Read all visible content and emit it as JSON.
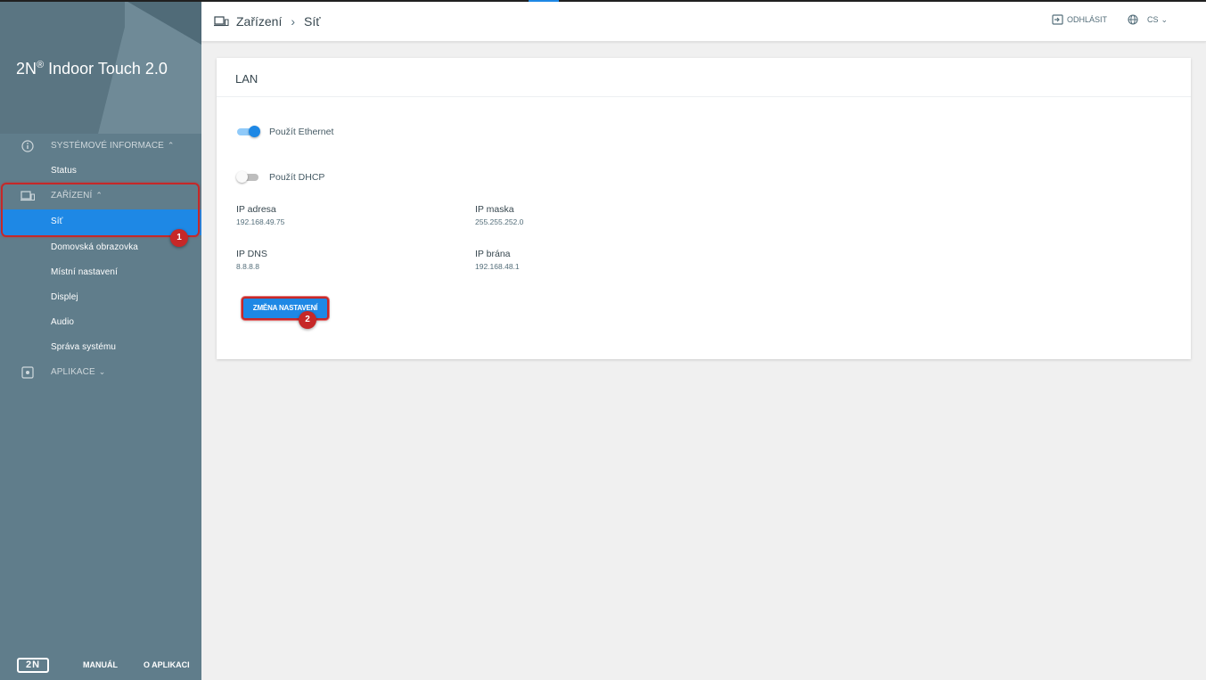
{
  "app": {
    "title": "2N",
    "title_sup": "®",
    "title_rest": " Indoor Touch 2.0"
  },
  "sidebar": {
    "sections": [
      {
        "label": "SYSTÉMOVÉ INFORMACE",
        "chevron": "^",
        "icon": "info-icon"
      },
      {
        "label": "ZAŘÍZENÍ",
        "chevron": "^",
        "icon": "devices-icon"
      },
      {
        "label": "APLIKACE",
        "chevron": "v",
        "icon": "apps-icon"
      }
    ],
    "items": {
      "status": "Status",
      "sit": "Síť",
      "domovska": "Domovská obrazovka",
      "mistni": "Místní nastavení",
      "displej": "Displej",
      "audio": "Audio",
      "sprava": "Správa systému"
    },
    "footer": {
      "logo": "2N",
      "manual": "MANUÁL",
      "about": "O APLIKACI"
    }
  },
  "header": {
    "breadcrumb": [
      "Zařízení",
      "›",
      "Síť"
    ],
    "logout": "ODHLÁSIT",
    "language": "CS",
    "lang_chevron": "⌄"
  },
  "card": {
    "title": "LAN",
    "toggles": [
      {
        "label": "Použít Ethernet",
        "on": true
      },
      {
        "label": "Použít DHCP",
        "on": false
      }
    ],
    "fields": {
      "ip_address": {
        "label": "IP adresa",
        "value": "192.168.49.75"
      },
      "ip_mask": {
        "label": "IP maska",
        "value": "255.255.252.0"
      },
      "ip_dns": {
        "label": "IP DNS",
        "value": "8.8.8.8"
      },
      "ip_gateway": {
        "label": "IP brána",
        "value": "192.168.48.1"
      }
    },
    "button": "ZMĚNA NASTAVENÍ"
  },
  "annotations": {
    "marker1": "1",
    "marker2": "2"
  },
  "colors": {
    "sidebar": "#607d8b",
    "accent": "#1e88e5",
    "annotation": "#c62828"
  }
}
